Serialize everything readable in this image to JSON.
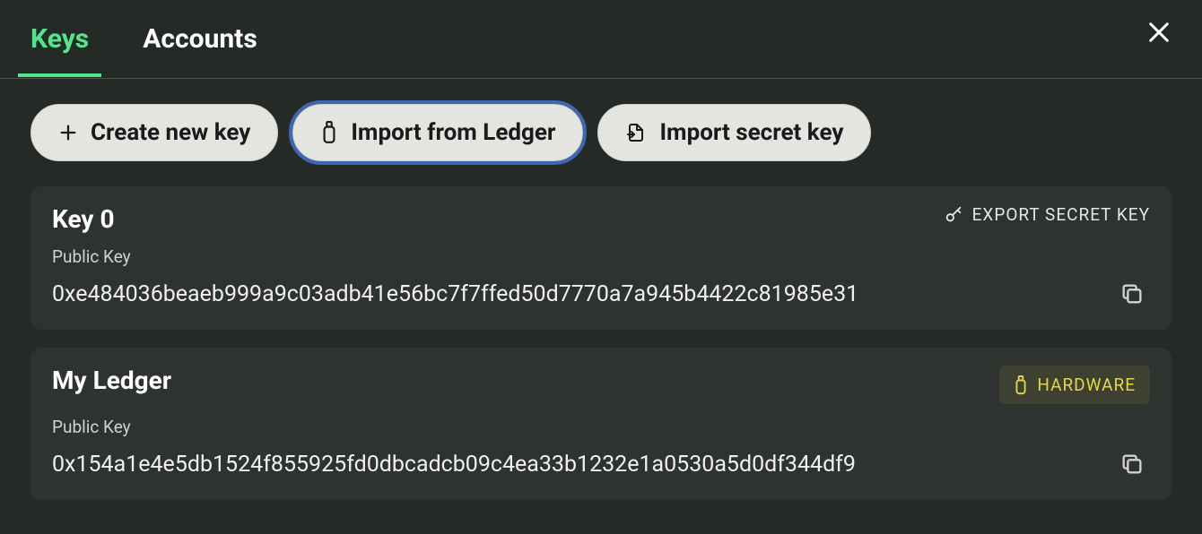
{
  "tabs": {
    "keys": "Keys",
    "accounts": "Accounts"
  },
  "actions": {
    "create": "Create new key",
    "import_ledger": "Import from Ledger",
    "import_secret": "Import secret key"
  },
  "labels": {
    "public_key": "Public Key",
    "export_secret": "EXPORT SECRET KEY",
    "hardware": "HARDWARE"
  },
  "keys": [
    {
      "name": "Key 0",
      "public_key": "0xe484036beaeb999a9c03adb41e56bc7f7ffed50d7770a7a945b4422c81985e31",
      "hardware": false
    },
    {
      "name": "My Ledger",
      "public_key": "0x154a1e4e5db1524f855925fd0dbcadcb09c4ea33b1232e1a0530a5d0df344df9",
      "hardware": true
    }
  ]
}
